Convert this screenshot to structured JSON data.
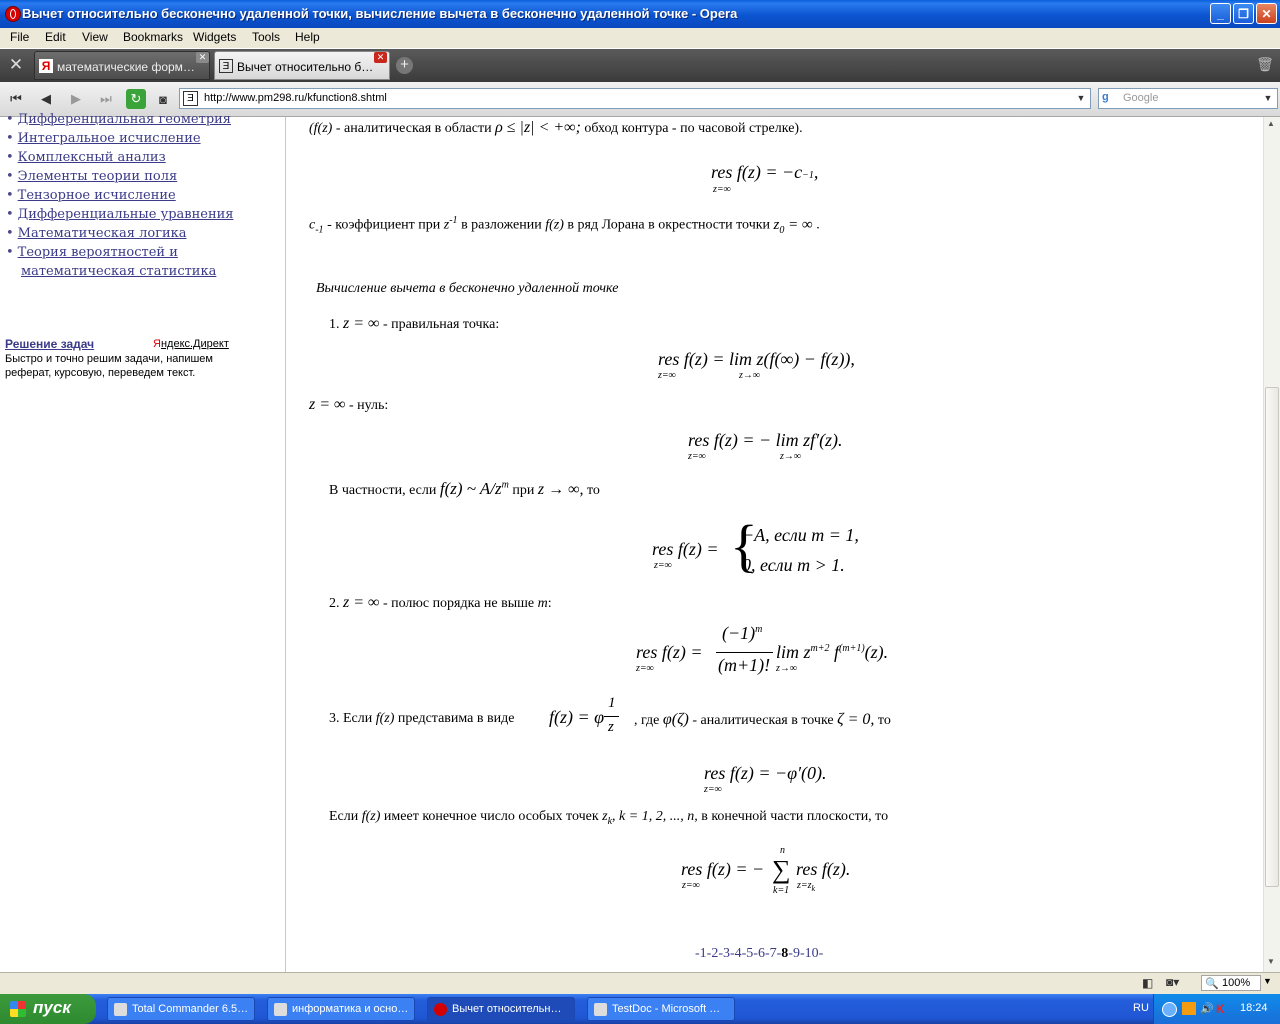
{
  "window": {
    "title": "Вычет относительно бесконечно удаленной точки, вычисление вычета в бесконечно удаленной точке - Opera",
    "minimize": "_",
    "maximize": "❐",
    "close": "✕"
  },
  "menu": [
    "File",
    "Edit",
    "View",
    "Bookmarks",
    "Widgets",
    "Tools",
    "Help"
  ],
  "tabs": [
    {
      "label": "математические форм…",
      "active": false
    },
    {
      "label": "Вычет относительно б…",
      "active": true
    }
  ],
  "address": {
    "url": "http://www.pm298.ru/kfunction8.shtml"
  },
  "search": {
    "placeholder": "Google"
  },
  "sidebar": {
    "links": [
      "Дифференциальная геометрия",
      "Интегральное исчисление",
      "Комплексный анализ",
      "Элементы теории поля",
      "Тензорное исчисление",
      "Дифференциальные уравнения",
      "Математическая логика",
      "Теория вероятностей и",
      "математическая статистика"
    ],
    "ad_title": "Решение задач",
    "ad_source_first": "Я",
    "ad_source_rest": "ндекс.Директ",
    "ad_text_1": "Быстро и точно решим задачи, напишем",
    "ad_text_2": "реферат, курсовую, переведем текст."
  },
  "article": {
    "line1_fz": "(f(z)",
    "line1_text": " - аналитическая в области ",
    "line1_cond": "ρ ≤ |z| < +∞;",
    "line1_text2": " обход контура - по часовой стрелке).",
    "formula1": "res f(z) = −c",
    "formula1_sub": "−1",
    "formula1_end": ",",
    "formula1_under": "z=∞",
    "line2_c": "c",
    "line2_c_sub": "-1",
    "line2_text": " - коэффициент при ",
    "line2_z": "z",
    "line2_zsup": "-1",
    "line2_text2": " в разложении ",
    "line2_fz": "f(z)",
    "line2_text3": " в ряд Лорана в окрестности точки ",
    "line2_z0": "z",
    "line2_z0sub": "0",
    "line2_z0eq": " = ∞",
    "line2_dot": " .",
    "section_heading": "Вычисление вычета в бесконечно удаленной точке",
    "item1_num": "1.",
    "item1_math": "z = ∞",
    "item1_text": " - правильная точка:",
    "formula2": "res f(z) = lim z(f(∞) − f(z)),",
    "formula2_under1": "z=∞",
    "formula2_under2": "z→∞",
    "line_null_math": "z = ∞",
    "line_null_text": " - нуль:",
    "formula3": "res f(z) = − lim zf′(z).",
    "formula3_under1": "z=∞",
    "formula3_under2": "z→∞",
    "particular_text1": "В частности, если ",
    "particular_math1": "f(z) ~ A/z",
    "particular_math1_sup": "m",
    "particular_text2": " при ",
    "particular_math2": "z → ∞,",
    "particular_text3": " то",
    "formula4_left": "res f(z) =",
    "formula4_under": "z=∞",
    "formula4_row1": "−A,   если   m = 1,",
    "formula4_row2": "0,      если   m > 1.",
    "item2_num": "2.",
    "item2_math": "z = ∞",
    "item2_text": " - полюс порядка не выше ",
    "item2_m": "m",
    "item2_colon": ":",
    "formula5_left": "res f(z) =",
    "formula5_under": "z=∞",
    "formula5_num": "(−1)",
    "formula5_num_sup": "m",
    "formula5_den": "(m+1)!",
    "formula5_right": "lim z",
    "formula5_right_sup": "m+2",
    "formula5_f": " f",
    "formula5_f_sup": "(m+1)",
    "formula5_end": "(z).",
    "formula5_under2": "z→∞",
    "item3_text1": "3. Если ",
    "item3_fz": "f(z)",
    "item3_text2": " представима в виде ",
    "item3_math1": "f(z) = φ",
    "item3_frac_num": "1",
    "item3_frac_den": "z",
    "item3_comma": ",",
    "item3_text3": " где ",
    "item3_math2": "φ(ζ)",
    "item3_text4": " - аналитическая в точке ",
    "item3_math3": "ζ = 0,",
    "item3_text5": " то",
    "formula6": "res f(z) = −φ′(0).",
    "formula6_under": "z=∞",
    "finite_text1": "Если ",
    "finite_fz": "f(z)",
    "finite_text2": " имеет конечное число особых точек ",
    "finite_z": "z",
    "finite_zsub": "k",
    "finite_text3": ", ",
    "finite_k": "k = 1, 2, ..., n,",
    "finite_text4": " в конечной части плоскости, то",
    "formula7_left": "res f(z) = −",
    "formula7_under": "z=∞",
    "formula7_sigma": "∑",
    "formula7_sigma_top": "n",
    "formula7_sigma_bot": "k=1",
    "formula7_right": "res f(z).",
    "formula7_under2": "z=z",
    "formula7_under2_sub": "k",
    "pager_before": "-1-2-3-4-5-6-7-",
    "pager_current": "8",
    "pager_after": "-9-10-"
  },
  "status": {
    "zoom": "100%"
  },
  "taskbar": {
    "start": "пуск",
    "tasks": [
      {
        "label": "Total Commander 6.5…",
        "active": false
      },
      {
        "label": "информатика и осно…",
        "active": false
      },
      {
        "label": "Вычет относительн…",
        "active": true
      },
      {
        "label": "TestDoc - Microsoft …",
        "active": false
      }
    ],
    "lang": "RU",
    "clock": "18:24"
  },
  "colors": {
    "link": "#3a3a88",
    "taskbar": "#245edb",
    "titlebar": "#0a55d0"
  }
}
